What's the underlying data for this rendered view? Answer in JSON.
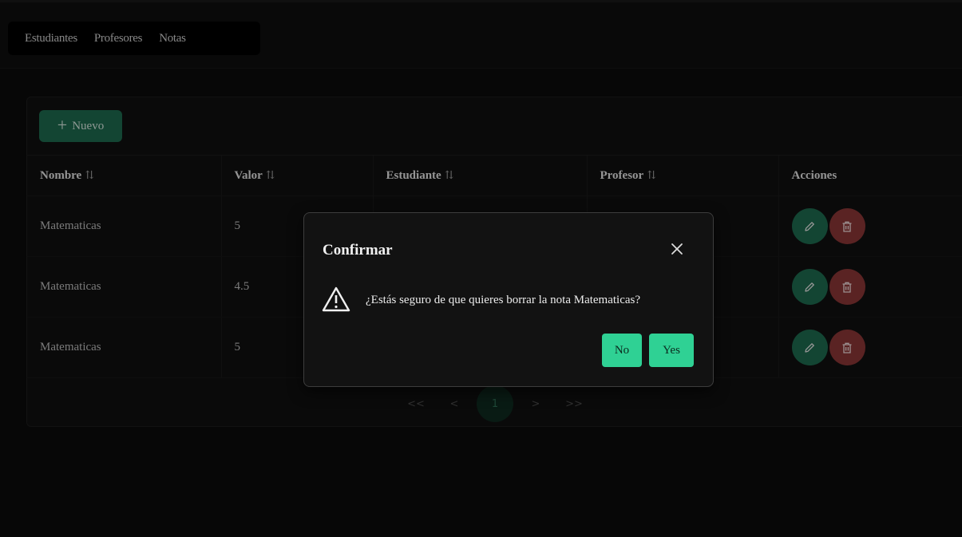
{
  "nav": {
    "items": [
      "Estudiantes",
      "Profesores",
      "Notas"
    ]
  },
  "toolbar": {
    "new_label": "Nuevo"
  },
  "table": {
    "columns": [
      "Nombre",
      "Valor",
      "Estudiante",
      "Profesor",
      "Acciones"
    ],
    "sort_glyph": "⇅",
    "rows": [
      {
        "nombre": "Matematicas",
        "valor": "5",
        "estudiante": "",
        "profesor": ""
      },
      {
        "nombre": "Matematicas",
        "valor": "4.5",
        "estudiante": "",
        "profesor": ""
      },
      {
        "nombre": "Matematicas",
        "valor": "5",
        "estudiante": "",
        "profesor": ""
      }
    ]
  },
  "pager": {
    "first": "<<",
    "prev": "<",
    "current": "1",
    "next": ">",
    "last": ">>"
  },
  "dialog": {
    "title": "Confirmar",
    "message": "¿Estás seguro de que quieres borrar la nota Matematicas?",
    "no_label": "No",
    "yes_label": "Yes"
  },
  "colors": {
    "accent": "#2fd194",
    "edit": "#1e6b4f",
    "delete": "#8a3636"
  },
  "icons": [
    "plus-icon",
    "sort-icon",
    "edit-icon",
    "trash-icon",
    "warning-icon",
    "close-icon"
  ]
}
